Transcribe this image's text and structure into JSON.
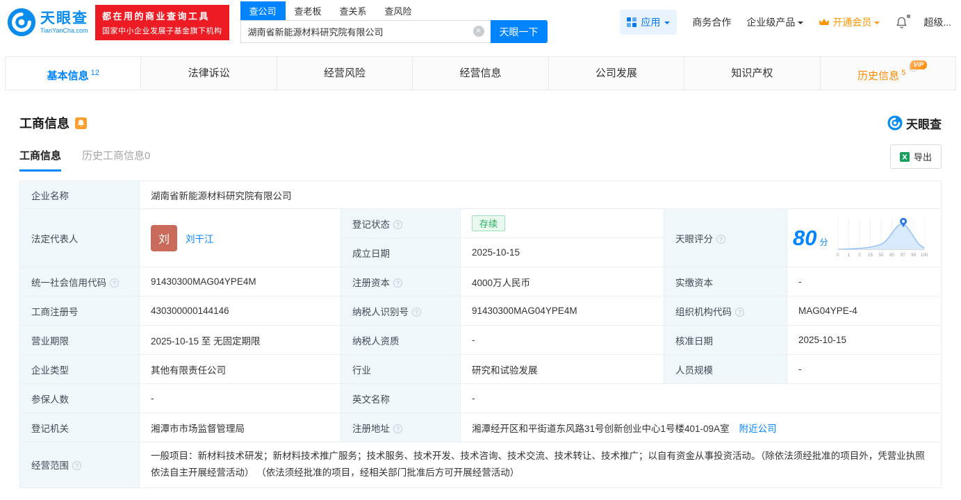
{
  "brand": {
    "name": "天眼查",
    "domain": "TianYanCha.com",
    "promo_line1": "都在用的商业查询工具",
    "promo_line2": "国家中小企业发展子基金旗下机构"
  },
  "header": {
    "search_tabs": [
      {
        "label": "查公司"
      },
      {
        "label": "查老板"
      },
      {
        "label": "查关系"
      },
      {
        "label": "查风险"
      }
    ],
    "search_value": "湖南省新能源材料研究院有限公司",
    "search_button": "天眼一下",
    "apps_label": "应用",
    "nav": {
      "cooperation": "商务合作",
      "enterprise": "企业级产品",
      "vip": "开通会员",
      "super": "超级..."
    }
  },
  "tabs": [
    {
      "label": "基本信息",
      "count": "12"
    },
    {
      "label": "法律诉讼"
    },
    {
      "label": "经营风险"
    },
    {
      "label": "经营信息"
    },
    {
      "label": "公司发展"
    },
    {
      "label": "知识产权"
    },
    {
      "label": "历史信息",
      "count": "5",
      "badge": "VIP"
    }
  ],
  "section": {
    "title": "工商信息",
    "watermark": "天眼查",
    "subtabs": [
      {
        "label": "工商信息"
      },
      {
        "label": "历史工商信息0"
      }
    ],
    "export_label": "导出"
  },
  "fields": {
    "company_name": {
      "label": "企业名称",
      "value": "湖南省新能源材料研究院有限公司"
    },
    "legal_rep": {
      "label": "法定代表人",
      "value": "刘干江",
      "avatar": "刘"
    },
    "reg_status": {
      "label": "登记状态",
      "value": "存续"
    },
    "establish_date": {
      "label": "成立日期",
      "value": "2025-10-15"
    },
    "score": {
      "label": "天眼评分",
      "value": "80",
      "unit": "分",
      "axis_ticks": [
        "0",
        "1",
        "3",
        "15",
        "50",
        "85",
        "97",
        "99",
        "100"
      ]
    },
    "credit_code": {
      "label": "统一社会信用代码",
      "value": "91430300MAG04YPE4M"
    },
    "reg_capital": {
      "label": "注册资本",
      "value": "4000万人民币"
    },
    "paid_capital": {
      "label": "实缴资本",
      "value": "-"
    },
    "reg_number": {
      "label": "工商注册号",
      "value": "430300000144146"
    },
    "taxpayer_id": {
      "label": "纳税人识别号",
      "value": "91430300MAG04YPE4M"
    },
    "org_code": {
      "label": "组织机构代码",
      "value": "MAG04YPE-4"
    },
    "business_term": {
      "label": "营业期限",
      "value": "2025-10-15 至 无固定期限"
    },
    "taxpayer_quality": {
      "label": "纳税人资质",
      "value": "-"
    },
    "approval_date": {
      "label": "核准日期",
      "value": "2025-10-15"
    },
    "company_type": {
      "label": "企业类型",
      "value": "其他有限责任公司"
    },
    "industry": {
      "label": "行业",
      "value": "研究和试验发展"
    },
    "staff_size": {
      "label": "人员规模",
      "value": "-"
    },
    "insured_count": {
      "label": "参保人数",
      "value": "-"
    },
    "english_name": {
      "label": "英文名称",
      "value": "-"
    },
    "reg_authority": {
      "label": "登记机关",
      "value": "湘潭市市场监督管理局"
    },
    "reg_address": {
      "label": "注册地址",
      "value": "湘潭经开区和平街道东风路31号创新创业中心1号楼401-09A室",
      "link": "附近公司"
    },
    "business_scope": {
      "label": "经营范围",
      "value": "一般项目：新材料技术研发；新材料技术推广服务；技术服务、技术开发、技术咨询、技术交流、技术转让、技术推广；以自有资金从事投资活动。（除依法须经批准的项目外，凭营业执照依法自主开展经营活动） （依法须经批准的项目，经相关部门批准后方可开展经营活动）"
    }
  },
  "chart_data": {
    "type": "area",
    "title": "天眼评分分布曲线",
    "score": 80,
    "x_ticks": [
      "0",
      "1",
      "3",
      "15",
      "50",
      "85",
      "97",
      "99",
      "100"
    ],
    "marker": "score-pin-at-80",
    "accent_color": "#2f7be5",
    "fill_color": "#d9eafc"
  },
  "colors": {
    "brand_blue": "#0084ff",
    "promo_red": "#ed1c24",
    "vip_orange": "#ff8a00",
    "status_green": "#23b159",
    "label_bg": "#f0f8fc"
  }
}
